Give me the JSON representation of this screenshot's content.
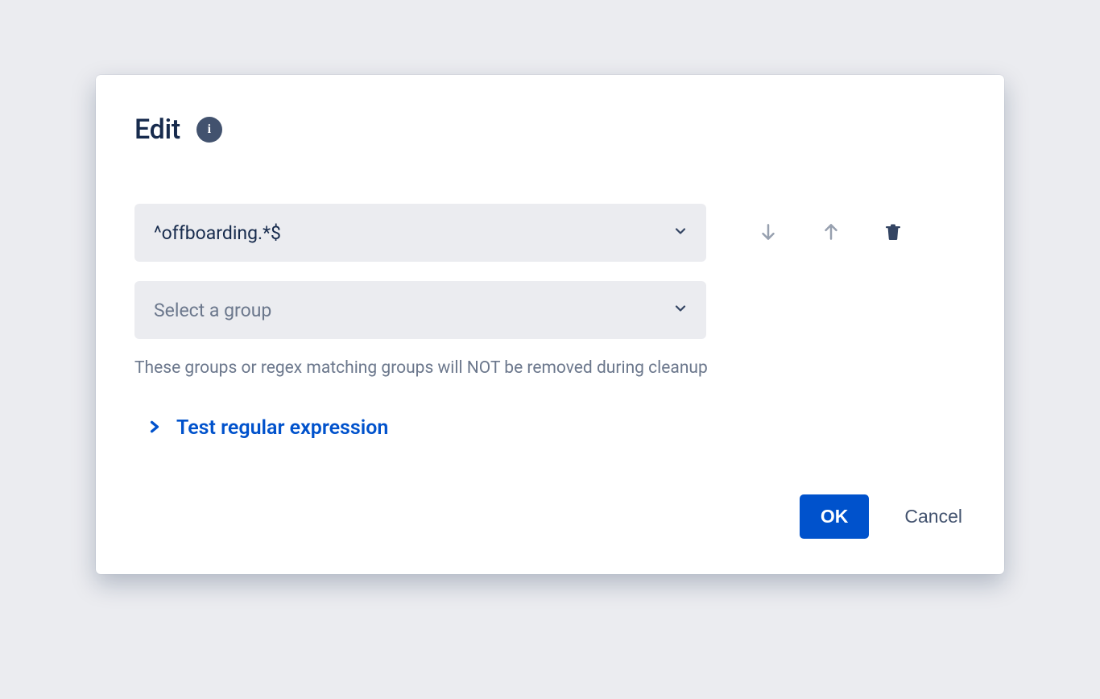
{
  "dialog": {
    "title": "Edit",
    "info_icon_label": "i",
    "rows": [
      {
        "value": "^offboarding.*$",
        "is_placeholder": false
      }
    ],
    "group_select_placeholder": "Select a group",
    "helper_text": "These groups or regex matching groups will NOT be removed during cleanup",
    "expander_label": "Test regular expression",
    "footer": {
      "ok_label": "OK",
      "cancel_label": "Cancel"
    }
  }
}
